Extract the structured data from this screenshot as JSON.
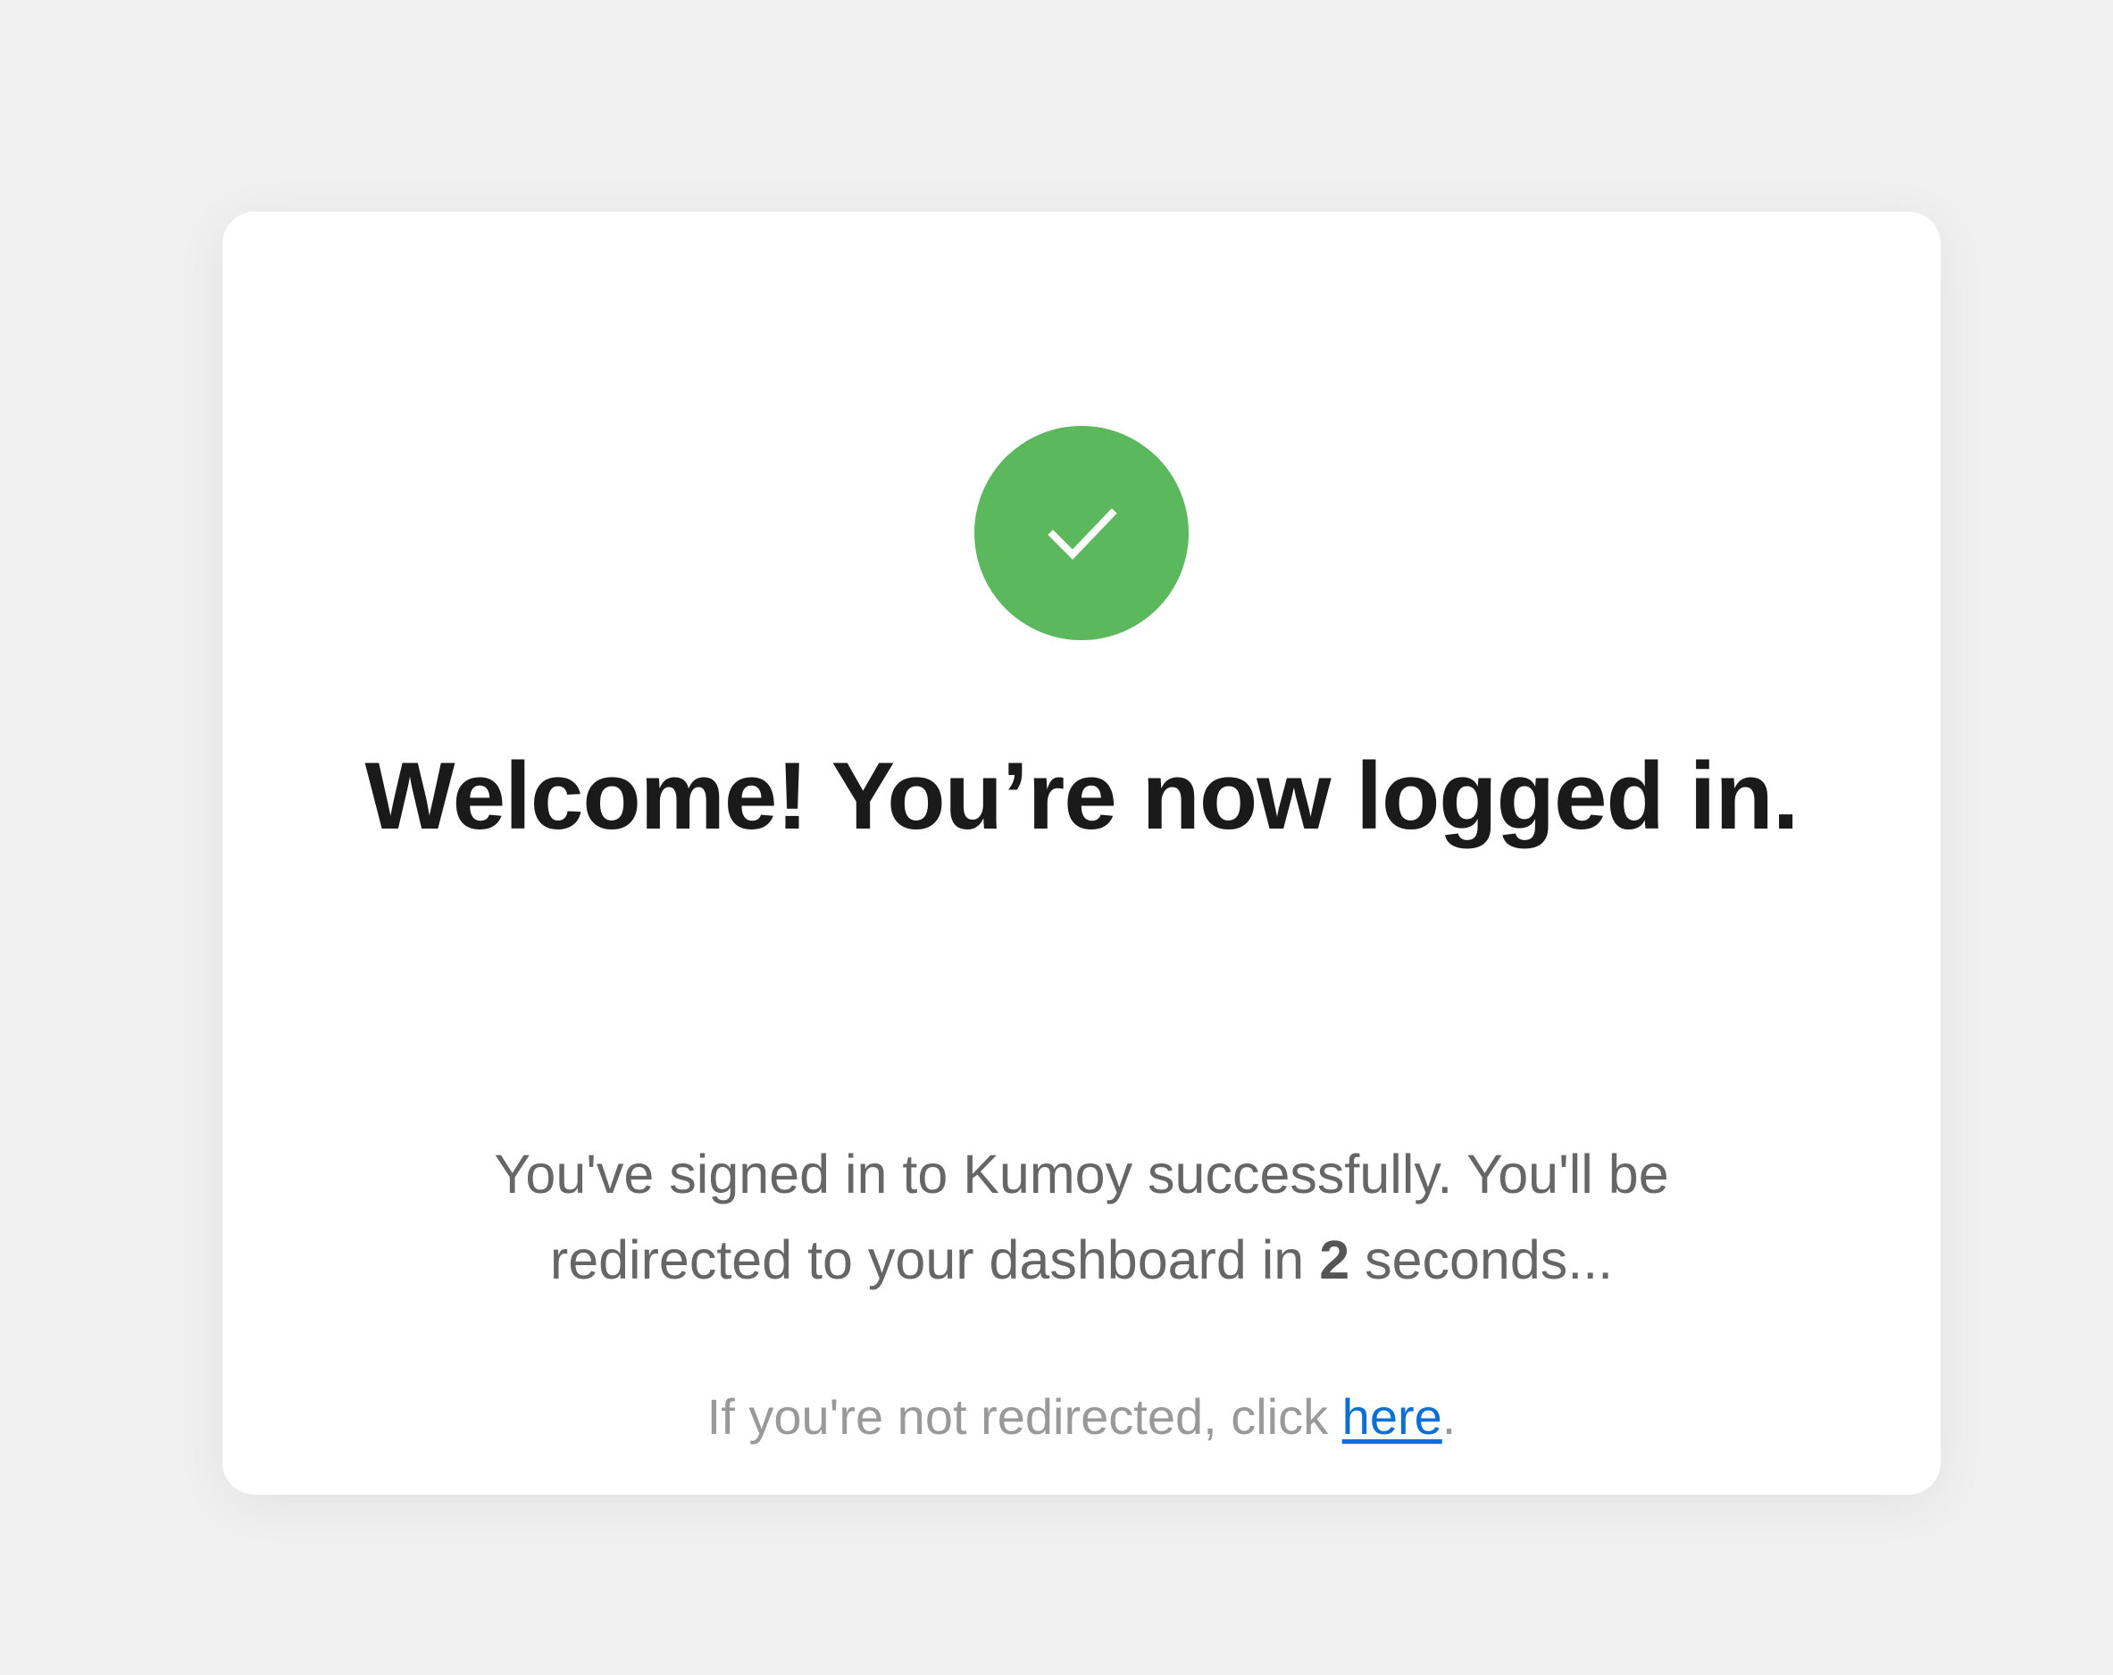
{
  "card": {
    "title": "Welcome! You’re now logged in.",
    "message": {
      "before_count": "You've signed in to Kumoy successfully. You'll be redirected to your dashboard in ",
      "count": "2",
      "after_count": " seconds..."
    },
    "fallback": {
      "prefix": "If you're not redirected, click ",
      "link_label": "here",
      "suffix": "."
    }
  },
  "icon": {
    "name": "check-icon",
    "color": "#5cb85c"
  }
}
